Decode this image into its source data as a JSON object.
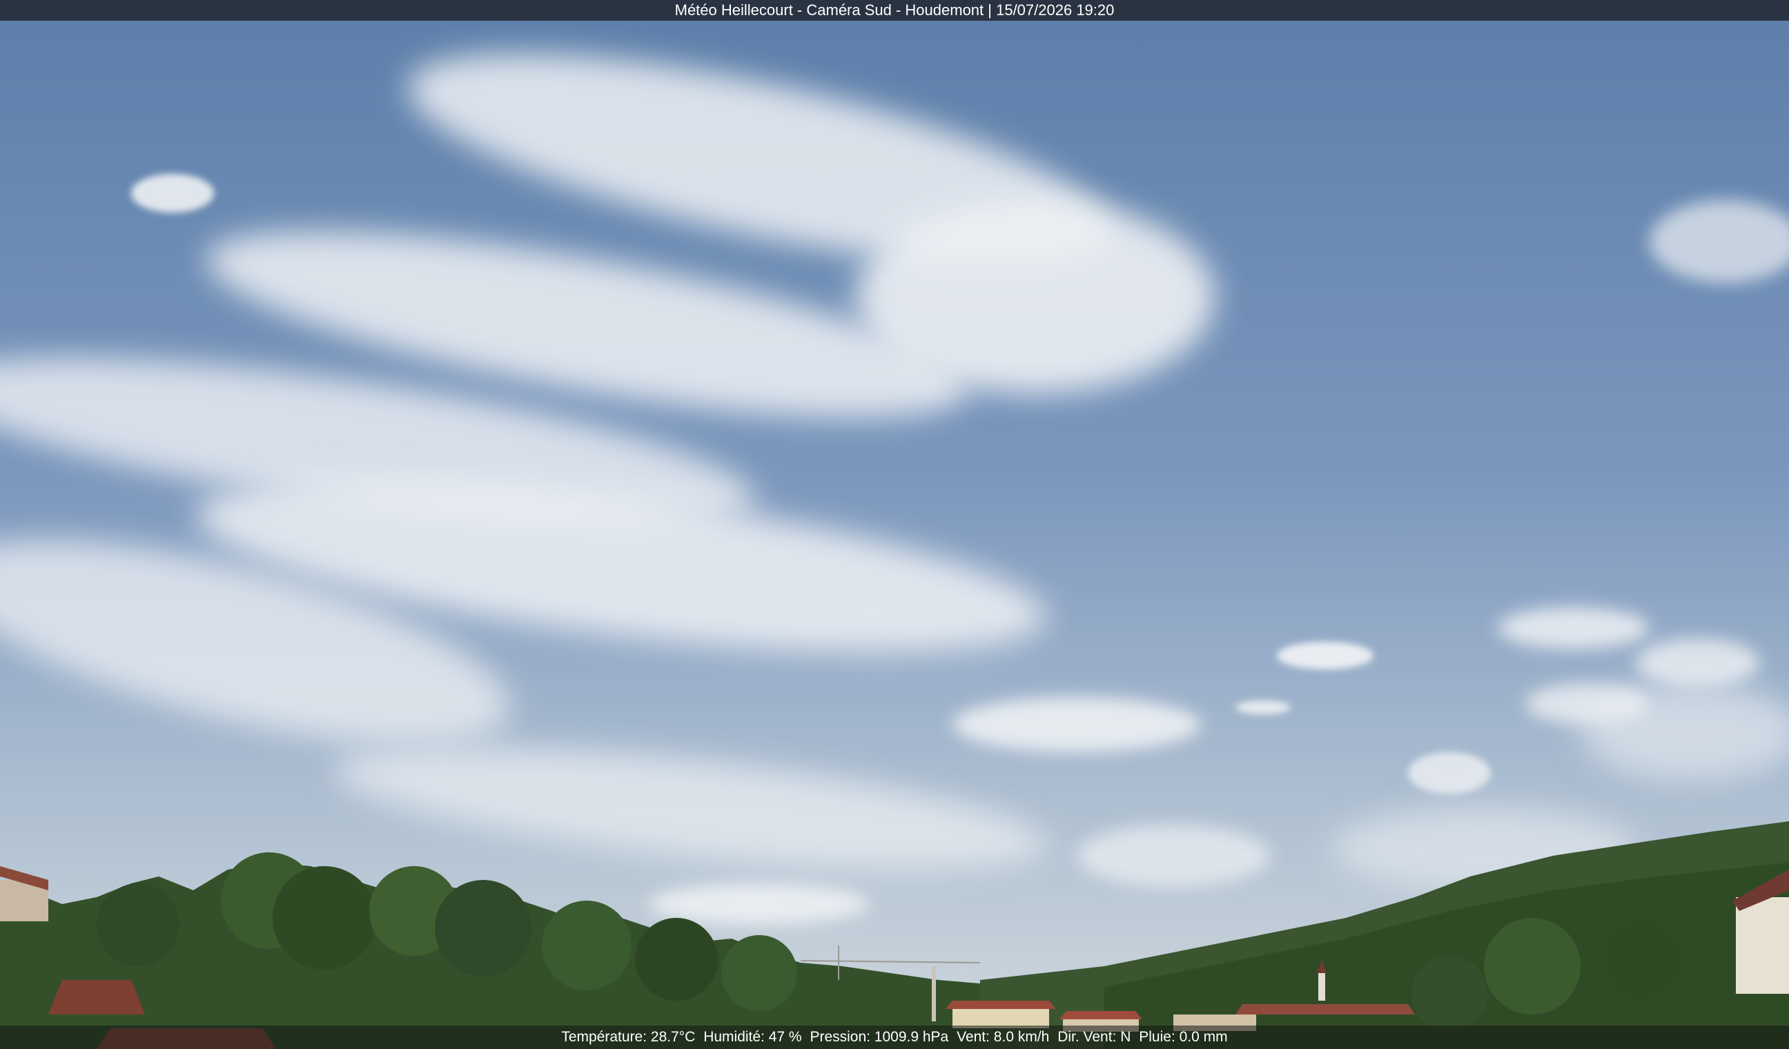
{
  "overlay": {
    "title": "Météo Heillecourt - Caméra Sud - Houdemont | 15/07/2026 19:20"
  },
  "readings": {
    "temperature": "Température: 28.7°C",
    "humidity": "Humidité: 47 %",
    "pressure": "Pression: 1009.9 hPa",
    "wind": "Vent: 8.0 km/h",
    "wind_direction": "Dir. Vent: N",
    "rain": "Pluie: 0.0 mm"
  },
  "colors": {
    "sky_top": "#5f80ab",
    "sky_bottom": "#c9d3dc",
    "cloud": "#eef1f4",
    "trees": "#2f4a24",
    "roof": "#8a4a3a",
    "overlay_bar": "#1c1e24"
  }
}
